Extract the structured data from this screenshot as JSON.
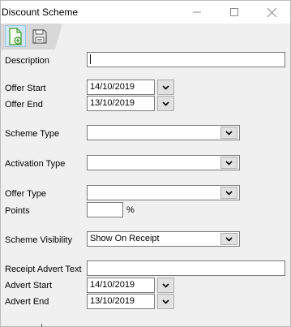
{
  "window": {
    "title": "Discount Scheme"
  },
  "titlebar_icons": {
    "minimize": "minimize-icon",
    "maximize": "maximize-icon",
    "close": "close-icon"
  },
  "toolbar": {
    "new_icon": "new-document-icon",
    "save_icon": "save-icon"
  },
  "form": {
    "description": {
      "label": "Description",
      "value": ""
    },
    "offer_start": {
      "label": "Offer Start",
      "value": "14/10/2019"
    },
    "offer_end": {
      "label": "Offer End",
      "value": "13/10/2019"
    },
    "scheme_type": {
      "label": "Scheme Type",
      "value": ""
    },
    "activation_type": {
      "label": "Activation Type",
      "value": ""
    },
    "offer_type": {
      "label": "Offer Type",
      "value": ""
    },
    "points": {
      "label": "Points",
      "value": "",
      "unit": "%"
    },
    "scheme_visibility": {
      "label": "Scheme Visibility",
      "value": "Show On Receipt"
    },
    "receipt_advert_text": {
      "label": "Receipt Advert Text",
      "value": ""
    },
    "advert_start": {
      "label": "Advert Start",
      "value": "14/10/2019"
    },
    "advert_end": {
      "label": "Advert End",
      "value": "13/10/2019"
    }
  }
}
